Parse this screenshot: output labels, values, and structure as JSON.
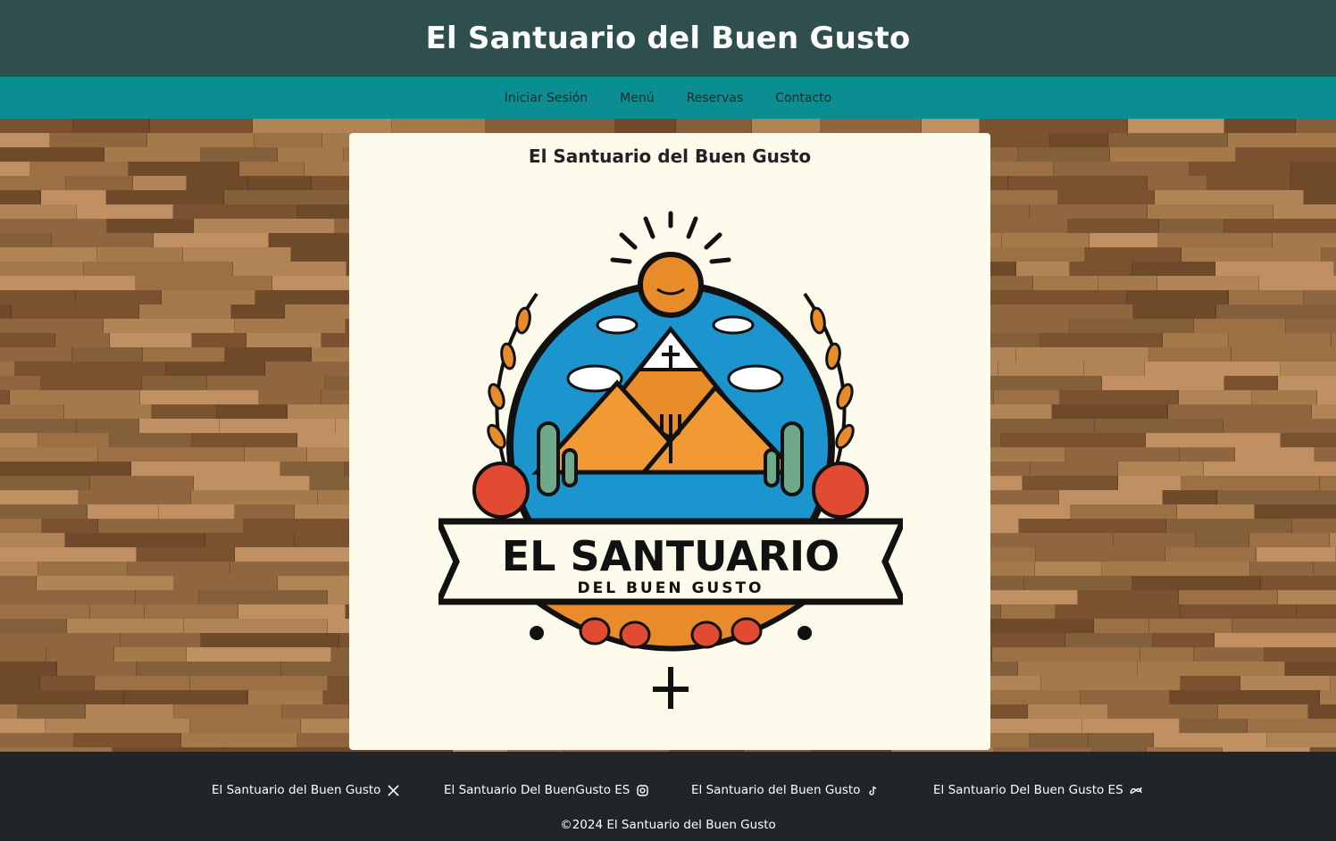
{
  "header": {
    "title": "El Santuario del Buen Gusto"
  },
  "nav": {
    "items": [
      {
        "label": "Iniciar Sesión"
      },
      {
        "label": "Menú"
      },
      {
        "label": "Reservas"
      },
      {
        "label": "Contacto"
      }
    ]
  },
  "card": {
    "title": "El Santuario del Buen Gusto",
    "logo": {
      "title": "EL SANTUARIO",
      "subtitle": "DEL BUEN GUSTO"
    }
  },
  "footer": {
    "social": [
      {
        "label": "El Santuario del Buen Gusto",
        "icon": "x-icon"
      },
      {
        "label": "El Santuario Del BuenGusto ES",
        "icon": "instagram-icon"
      },
      {
        "label": "El Santuario del Buen Gusto",
        "icon": "tiktok-icon"
      },
      {
        "label": "El Santuario Del Buen Gusto ES",
        "icon": "meta-icon"
      }
    ],
    "copyright": "©2024 El Santuario del Buen Gusto"
  },
  "colors": {
    "header_bg": "#2f4f4f",
    "nav_bg": "#0b8e92",
    "card_bg": "#fdfbec",
    "footer_bg": "#212529"
  }
}
